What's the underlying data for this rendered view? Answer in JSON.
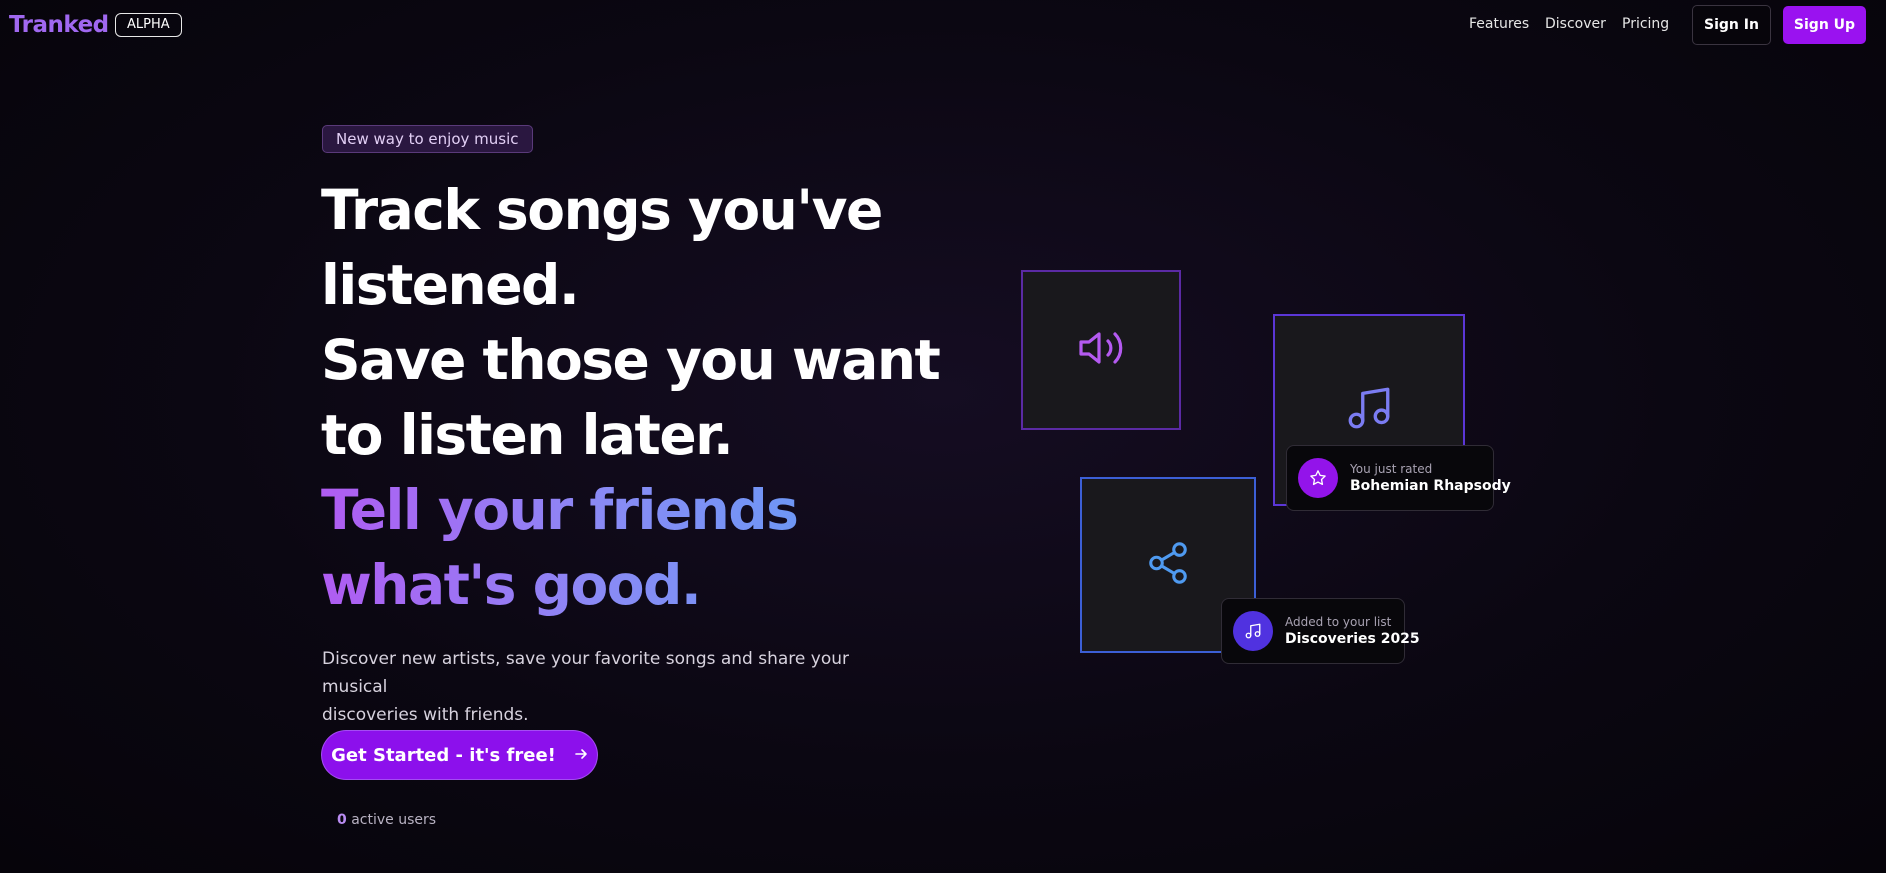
{
  "header": {
    "logo": "Tranked",
    "badge": "ALPHA",
    "nav": [
      "Features",
      "Discover",
      "Pricing"
    ],
    "sign_in": "Sign In",
    "sign_up": "Sign Up"
  },
  "hero": {
    "tag": "New way to enjoy music",
    "headline": {
      "line1": "Track songs you've",
      "line2": "listened.",
      "line3": "Save those you want",
      "line4": "to listen later.",
      "line5": "Tell your friends",
      "line6": "what's good."
    },
    "subtitle_line1": "Discover new artists, save your favorite songs and share your musical",
    "subtitle_line2": "discoveries with friends.",
    "cta": "Get Started - it's free!",
    "cta_icon": "arrow-right-icon",
    "active_users_count": "0",
    "active_users_label": "active users"
  },
  "illustration": {
    "tiles": [
      {
        "icon": "speaker-icon",
        "color": "#b45af0"
      },
      {
        "icon": "music-note-icon",
        "color": "#7b7cf2"
      },
      {
        "icon": "share-icon",
        "color": "#4f9af0"
      }
    ],
    "notifications": [
      {
        "icon": "star-icon",
        "caption": "You just rated",
        "title": "Bohemian Rhapsody"
      },
      {
        "icon": "music-note-icon",
        "caption": "Added to your list",
        "title": "Discoveries 2025"
      }
    ]
  },
  "colors": {
    "accent": "#9a12f0",
    "logo": "#a068f0",
    "background": "#0b0712"
  }
}
